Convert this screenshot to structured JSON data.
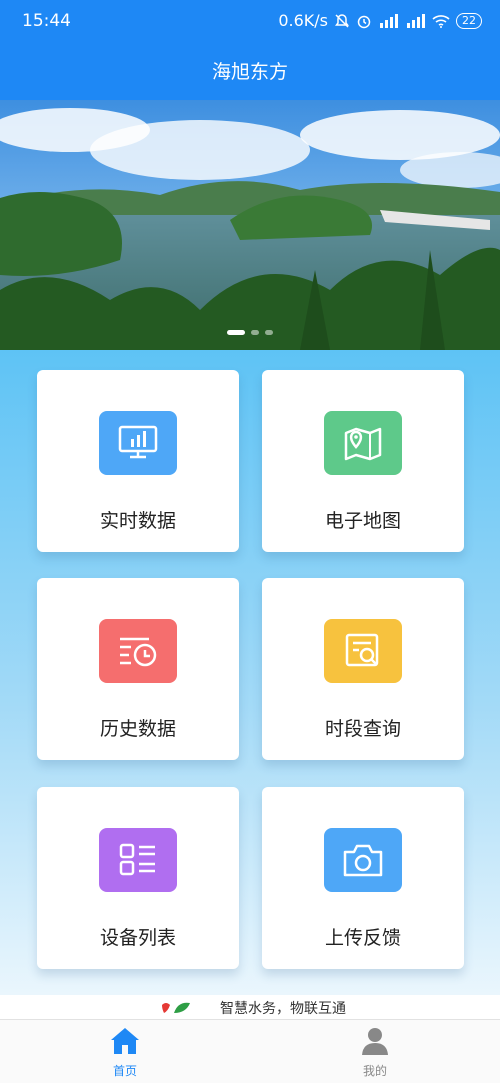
{
  "status_bar": {
    "time": "15:44",
    "speed": "0.6K/s",
    "battery": "22"
  },
  "header": {
    "title": "海旭东方"
  },
  "banner": {
    "slides": 3,
    "active_slide": 1
  },
  "menu": {
    "items": [
      {
        "label": "实时数据",
        "icon": "monitor-chart-icon",
        "color": "#4ea7f7"
      },
      {
        "label": "电子地图",
        "icon": "map-pin-icon",
        "color": "#5ec98a"
      },
      {
        "label": "历史数据",
        "icon": "history-clock-icon",
        "color": "#f56e6e"
      },
      {
        "label": "时段查询",
        "icon": "document-search-icon",
        "color": "#f7c23e"
      },
      {
        "label": "设备列表",
        "icon": "device-list-icon",
        "color": "#b06ef0"
      },
      {
        "label": "上传反馈",
        "icon": "camera-icon",
        "color": "#4ea7f7"
      }
    ]
  },
  "footer": {
    "slogan": "智慧水务，物联互通"
  },
  "tabbar": {
    "items": [
      {
        "label": "首页",
        "icon": "home-icon",
        "active": true,
        "color": "#1e88f5"
      },
      {
        "label": "我的",
        "icon": "user-icon",
        "active": false,
        "color": "#888888"
      }
    ]
  }
}
